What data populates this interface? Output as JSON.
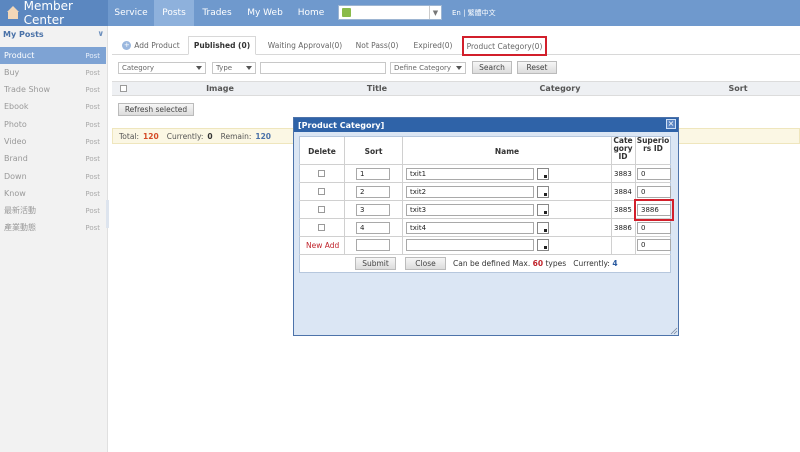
{
  "app": {
    "title": "Member Center"
  },
  "nav": {
    "items": [
      "Service",
      "Posts",
      "Trades",
      "My Web",
      "Home"
    ],
    "active": "Posts",
    "site_select_value": "",
    "lang": "En | 繁體中文"
  },
  "sidebar": {
    "title": "My Posts",
    "items": [
      {
        "label": "Product",
        "post": "Post"
      },
      {
        "label": "Buy",
        "post": "Post"
      },
      {
        "label": "Trade Show",
        "post": "Post"
      },
      {
        "label": "Ebook",
        "post": "Post"
      },
      {
        "label": "Photo",
        "post": "Post"
      },
      {
        "label": "Video",
        "post": "Post"
      },
      {
        "label": "Brand",
        "post": "Post"
      },
      {
        "label": "Down",
        "post": "Post"
      },
      {
        "label": "Know",
        "post": "Post"
      },
      {
        "label": "最新活動",
        "post": "Post"
      },
      {
        "label": "產業動態",
        "post": "Post"
      }
    ],
    "active": "Product"
  },
  "tabs": {
    "add_product": "Add Product",
    "published": "Published (0)",
    "waiting": "Waiting Approval(0)",
    "not_pass": "Not Pass(0)",
    "expired": "Expired(0)",
    "product_category": "Product Category(0)"
  },
  "filters": {
    "category": "Category",
    "type": "Type",
    "keyword": "",
    "define_category": "Define Category",
    "search": "Search",
    "reset": "Reset"
  },
  "grid": {
    "columns": [
      "Image",
      "Title",
      "Category",
      "Sort"
    ],
    "refresh": "Refresh selected"
  },
  "totals": {
    "total_label": "Total:",
    "total": "120",
    "current_label": "Currently:",
    "current": "0",
    "remain_label": "Remain:",
    "remain": "120"
  },
  "dialog": {
    "title": "[Product Category]",
    "columns": {
      "delete": "Delete",
      "sort": "Sort",
      "name": "Name",
      "category_id": "Category ID",
      "superiors_id": "Superiors ID"
    },
    "rows": [
      {
        "sort": "1",
        "name": "txit1",
        "id": "3883",
        "superior": "0"
      },
      {
        "sort": "2",
        "name": "txit2",
        "id": "3884",
        "superior": "0"
      },
      {
        "sort": "3",
        "name": "txit3",
        "id": "3885",
        "superior": "3886"
      },
      {
        "sort": "4",
        "name": "txit4",
        "id": "3886",
        "superior": "0"
      }
    ],
    "new_add": {
      "label": "New Add",
      "sort": "",
      "name": "",
      "superior": "0"
    },
    "submit": "Submit",
    "close": "Close",
    "max_text_pre": "Can be defined Max.",
    "max": "60",
    "max_text_post": "types",
    "current_label": "Currently:",
    "current": "4"
  },
  "colors": {
    "highlight": "#d21f2b",
    "topbar": "#6f99cd",
    "dialog_title": "#2f63a8"
  }
}
